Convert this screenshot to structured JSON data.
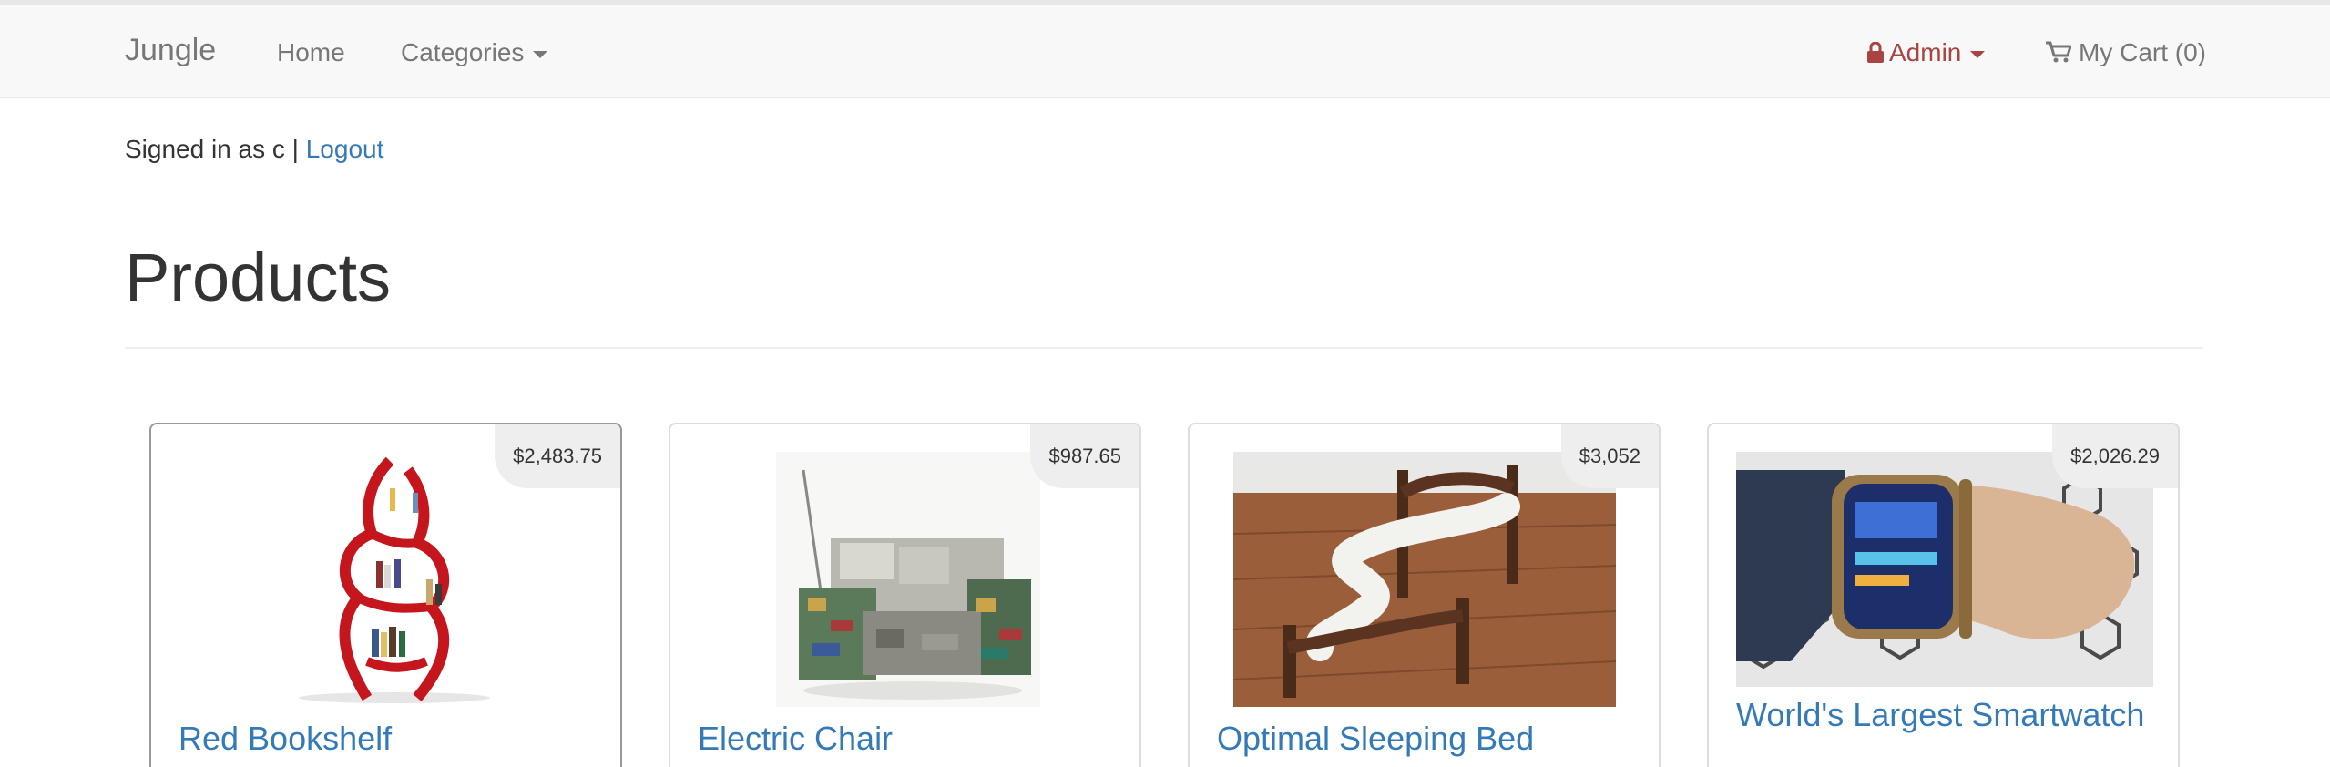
{
  "navbar": {
    "brand": "Jungle",
    "home": "Home",
    "categories": "Categories",
    "admin": "Admin",
    "cart": "My Cart (0)"
  },
  "session": {
    "signed_in_text": "Signed in as c |",
    "logout": "Logout"
  },
  "page": {
    "title": "Products"
  },
  "products": [
    {
      "name": "Red Bookshelf",
      "price": "$2,483.75"
    },
    {
      "name": "Electric Chair",
      "price": "$987.65"
    },
    {
      "name": "Optimal Sleeping Bed",
      "price": "$3,052"
    },
    {
      "name": "World's Largest Smartwatch",
      "price": "$2,026.29"
    }
  ],
  "colors": {
    "link": "#337ab7",
    "admin": "#a94442",
    "navbar_bg": "#f8f8f8"
  }
}
